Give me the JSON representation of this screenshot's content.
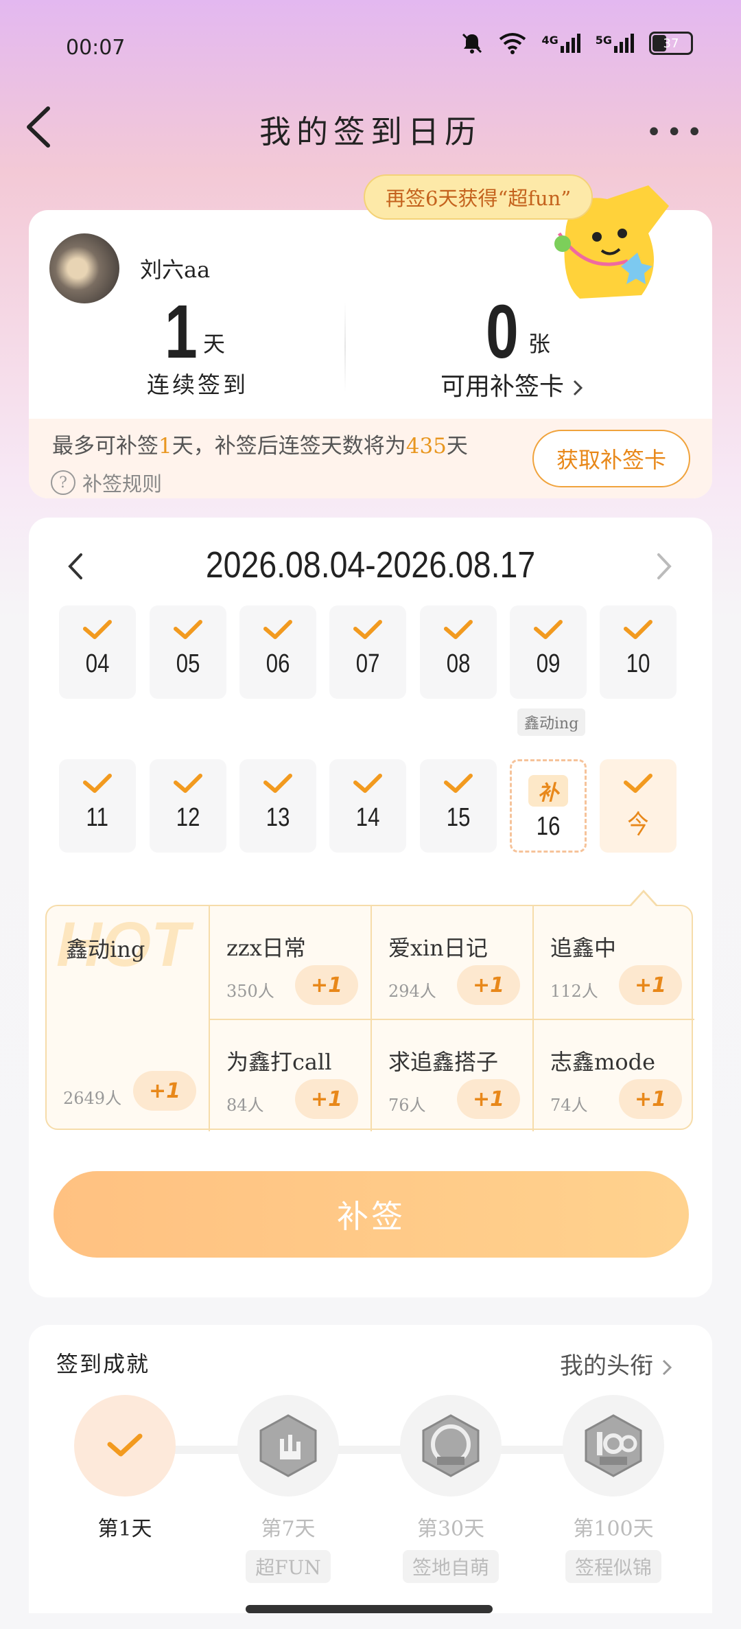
{
  "status_bar": {
    "time": "00:07",
    "network_1": "4G",
    "network_2": "5G",
    "battery": "37"
  },
  "header": {
    "title": "我的签到日历",
    "more": "•••"
  },
  "summary": {
    "bubble": "再签6天获得“超fun”",
    "username": "刘六aa",
    "streak_value": "1",
    "streak_unit": "天",
    "streak_label": "连续签到",
    "cards_value": "0",
    "cards_unit": "张",
    "cards_label": "可用补签卡",
    "hint_prefix": "最多可补签",
    "hint_n": "1",
    "hint_mid": "天，补签后连签天数将为",
    "hint_total": "435",
    "hint_suffix": "天",
    "rule_label": "补签规则",
    "get_card_button": "获取补签卡"
  },
  "calendar": {
    "range": "2026.08.04-2026.08.17",
    "row1": [
      "04",
      "05",
      "06",
      "07",
      "08",
      "09",
      "10"
    ],
    "row2": [
      "11",
      "12",
      "13",
      "14",
      "15"
    ],
    "makeup_day": "16",
    "makeup_badge": "补",
    "today_label": "今",
    "day09_tag": "鑫动ing"
  },
  "topics": {
    "hot_watermark": "HOT",
    "hot": {
      "name": "鑫动ing",
      "count": "2649人",
      "plus": "+1"
    },
    "items": [
      {
        "name": "zzx日常",
        "count": "350人",
        "plus": "+1"
      },
      {
        "name": "爱xin日记",
        "count": "294人",
        "plus": "+1"
      },
      {
        "name": "追鑫中",
        "count": "112人",
        "plus": "+1"
      },
      {
        "name": "为鑫打call",
        "count": "84人",
        "plus": "+1"
      },
      {
        "name": "求追鑫搭子",
        "count": "76人",
        "plus": "+1"
      },
      {
        "name": "志鑫mode",
        "count": "74人",
        "plus": "+1"
      }
    ]
  },
  "makeup_button": "补签",
  "achievements": {
    "title": "签到成就",
    "link": "我的头衔",
    "items": [
      {
        "label": "第1天",
        "tag": ""
      },
      {
        "label": "第7天",
        "tag": "超FUN"
      },
      {
        "label": "第30天",
        "tag": "签地自萌"
      },
      {
        "label": "第100天",
        "tag": "签程似锦"
      }
    ]
  },
  "colors": {
    "accent": "#e8881a",
    "button_gradient_start": "#ffc181",
    "button_gradient_end": "#ffd28e"
  }
}
